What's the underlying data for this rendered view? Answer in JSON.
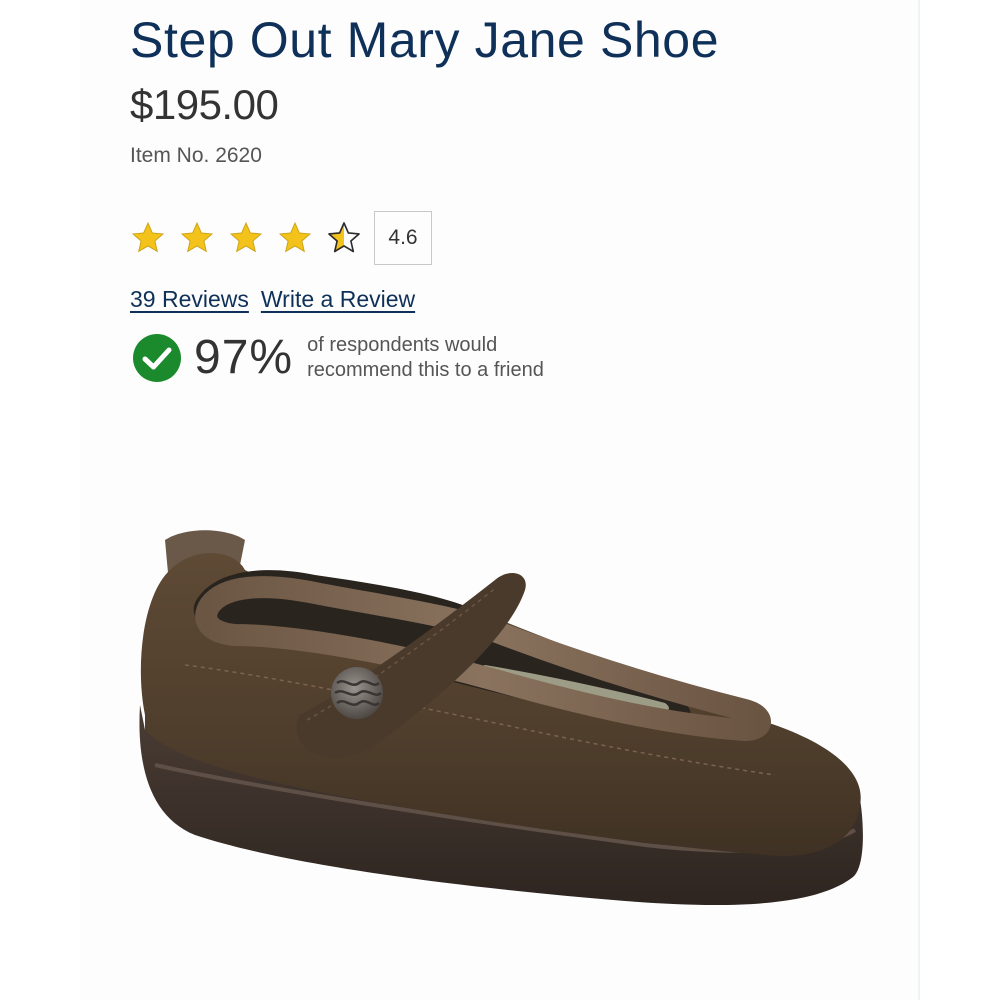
{
  "product": {
    "title": "Step Out Mary Jane Shoe",
    "price": "$195.00",
    "item_number": "Item No. 2620",
    "image_alt": "Brown Mary Jane shoe with strap and button"
  },
  "rating": {
    "value": "4.6",
    "stars_filled": 4.5,
    "stars_total": 5,
    "star_color": "#f3c21b"
  },
  "links": {
    "reviews": "39 Reviews",
    "write_review": "Write a Review"
  },
  "recommendation": {
    "percent": "97%",
    "text": "of respondents would recommend this to a friend",
    "icon": "check-circle-icon",
    "icon_color": "#1a8a2c"
  },
  "colors": {
    "title": "#0f3058",
    "link": "#0f3058",
    "text": "#333333"
  }
}
